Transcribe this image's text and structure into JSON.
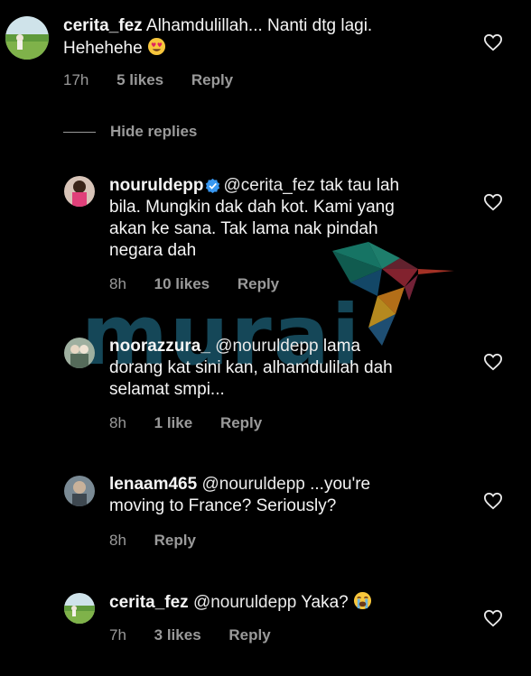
{
  "comments": [
    {
      "username": "cerita_fez",
      "text_line1": "Alhamdulillah... Nanti dtg lagi.",
      "text_line2": "Hehehehe",
      "emoji": "heart-eyes-emoji",
      "time": "17h",
      "likes": "5 likes",
      "reply": "Reply"
    },
    {
      "username": "nouruldepp",
      "verified": true,
      "mention": "@cerita_fez",
      "text_line1": "tak tau lah",
      "text_line2": "bila. Mungkin dak dah kot. Kami yang",
      "text_line3": "akan ke sana. Tak lama nak pindah",
      "text_line4": "negara dah",
      "time": "8h",
      "likes": "10 likes",
      "reply": "Reply"
    },
    {
      "username": "noorazzura_",
      "mention": "@nouruldepp",
      "text_line1": "lama",
      "text_line2": "dorang kat sini kan, alhamdulilah dah",
      "text_line3": "selamat smpi...",
      "time": "8h",
      "likes": "1 like",
      "reply": "Reply"
    },
    {
      "username": "lenaam465",
      "mention": "@nouruldepp",
      "text_line1": "...you're",
      "text_line2": "moving to France? Seriously?",
      "time": "8h",
      "reply": "Reply"
    },
    {
      "username": "cerita_fez",
      "mention": "@nouruldepp",
      "text_line1": "Yaka?",
      "emoji": "crying-emoji",
      "time": "7h",
      "likes": "3 likes",
      "reply": "Reply"
    }
  ],
  "hide_replies": "Hide replies",
  "watermark": "murai",
  "colors": {
    "background": "#000000",
    "text": "#f5f5f5",
    "meta": "#9a9a9a",
    "verified": "#3897f0"
  }
}
